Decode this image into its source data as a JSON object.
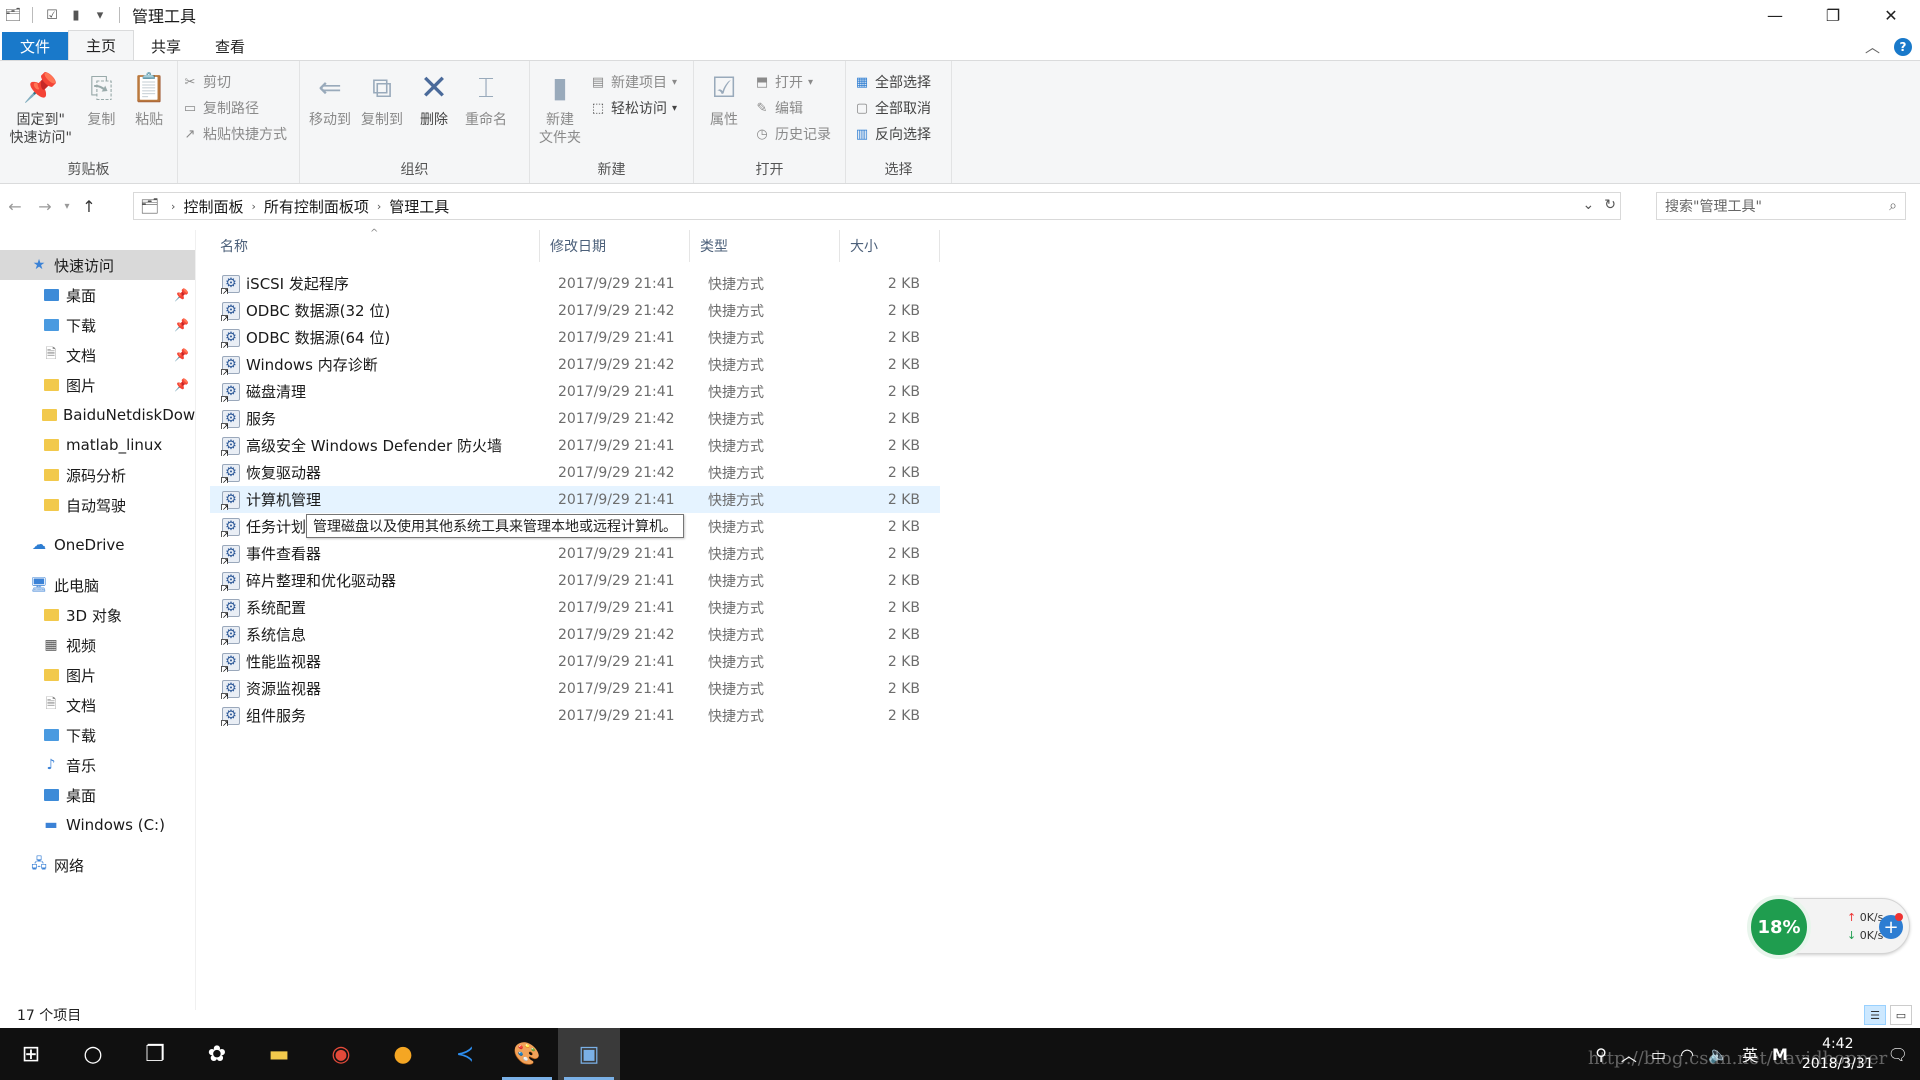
{
  "window": {
    "title": "管理工具",
    "controls": {
      "minimize": "—",
      "maximize": "❐",
      "close": "✕"
    }
  },
  "ribbon": {
    "tabs": [
      {
        "label": "文件"
      },
      {
        "label": "主页"
      },
      {
        "label": "共享"
      },
      {
        "label": "查看"
      }
    ],
    "clipboard": {
      "label": "剪贴板",
      "pin": "固定到\"\n快速访问\"",
      "copy": "复制",
      "paste": "粘贴",
      "cut": "剪切",
      "copy_path": "复制路径",
      "paste_shortcut": "粘贴快捷方式"
    },
    "organize": {
      "label": "组织",
      "move_to": "移动到",
      "copy_to": "复制到",
      "delete": "删除",
      "rename": "重命名"
    },
    "new": {
      "label": "新建",
      "new_folder": "新建\n文件夹",
      "new_item": "新建项目",
      "easy_access": "轻松访问"
    },
    "open": {
      "label": "打开",
      "properties": "属性",
      "open": "打开",
      "edit": "编辑",
      "history": "历史记录"
    },
    "select": {
      "label": "选择",
      "select_all": "全部选择",
      "select_none": "全部取消",
      "invert": "反向选择"
    }
  },
  "address": {
    "crumbs": [
      "控制面板",
      "所有控制面板项",
      "管理工具"
    ],
    "search_placeholder": "搜索\"管理工具\""
  },
  "nav": {
    "quick_access": "快速访问",
    "quick_items": [
      "桌面",
      "下载",
      "文档",
      "图片",
      "BaiduNetdiskDow",
      "matlab_linux",
      "源码分析",
      "自动驾驶"
    ],
    "onedrive": "OneDrive",
    "this_pc": "此电脑",
    "pc_items": [
      "3D 对象",
      "视频",
      "图片",
      "文档",
      "下载",
      "音乐",
      "桌面",
      "Windows (C:)"
    ],
    "network": "网络"
  },
  "list": {
    "headers": {
      "name": "名称",
      "date": "修改日期",
      "type": "类型",
      "size": "大小"
    },
    "rows": [
      {
        "name": "iSCSI 发起程序",
        "date": "2017/9/29 21:41",
        "type": "快捷方式",
        "size": "2 KB"
      },
      {
        "name": "ODBC 数据源(32 位)",
        "date": "2017/9/29 21:42",
        "type": "快捷方式",
        "size": "2 KB"
      },
      {
        "name": "ODBC 数据源(64 位)",
        "date": "2017/9/29 21:41",
        "type": "快捷方式",
        "size": "2 KB"
      },
      {
        "name": "Windows 内存诊断",
        "date": "2017/9/29 21:42",
        "type": "快捷方式",
        "size": "2 KB"
      },
      {
        "name": "磁盘清理",
        "date": "2017/9/29 21:41",
        "type": "快捷方式",
        "size": "2 KB"
      },
      {
        "name": "服务",
        "date": "2017/9/29 21:42",
        "type": "快捷方式",
        "size": "2 KB"
      },
      {
        "name": "高级安全 Windows Defender 防火墙",
        "date": "2017/9/29 21:41",
        "type": "快捷方式",
        "size": "2 KB"
      },
      {
        "name": "恢复驱动器",
        "date": "2017/9/29 21:42",
        "type": "快捷方式",
        "size": "2 KB"
      },
      {
        "name": "计算机管理",
        "date": "2017/9/29 21:41",
        "type": "快捷方式",
        "size": "2 KB"
      },
      {
        "name": "任务计划程序",
        "date": "2017/9/29 21:41",
        "type": "快捷方式",
        "size": "2 KB"
      },
      {
        "name": "事件查看器",
        "date": "2017/9/29 21:41",
        "type": "快捷方式",
        "size": "2 KB"
      },
      {
        "name": "碎片整理和优化驱动器",
        "date": "2017/9/29 21:41",
        "type": "快捷方式",
        "size": "2 KB"
      },
      {
        "name": "系统配置",
        "date": "2017/9/29 21:41",
        "type": "快捷方式",
        "size": "2 KB"
      },
      {
        "name": "系统信息",
        "date": "2017/9/29 21:42",
        "type": "快捷方式",
        "size": "2 KB"
      },
      {
        "name": "性能监视器",
        "date": "2017/9/29 21:41",
        "type": "快捷方式",
        "size": "2 KB"
      },
      {
        "name": "资源监视器",
        "date": "2017/9/29 21:41",
        "type": "快捷方式",
        "size": "2 KB"
      },
      {
        "name": "组件服务",
        "date": "2017/9/29 21:41",
        "type": "快捷方式",
        "size": "2 KB"
      }
    ],
    "tooltip": "管理磁盘以及使用其他系统工具来管理本地或远程计算机。"
  },
  "status": {
    "count": "17 个项目"
  },
  "net_widget": {
    "percent": "18%",
    "up": "0K/s",
    "down": "0K/s"
  },
  "taskbar": {
    "time": "4:42",
    "date": "2018/3/31",
    "ime": "英",
    "ime2": "M"
  },
  "watermark": "http://blog.csdn.net/davidhopper",
  "colors": {
    "accent": "#1979ca",
    "hover_row": "#e5f3ff",
    "taskbar": "#101010"
  }
}
